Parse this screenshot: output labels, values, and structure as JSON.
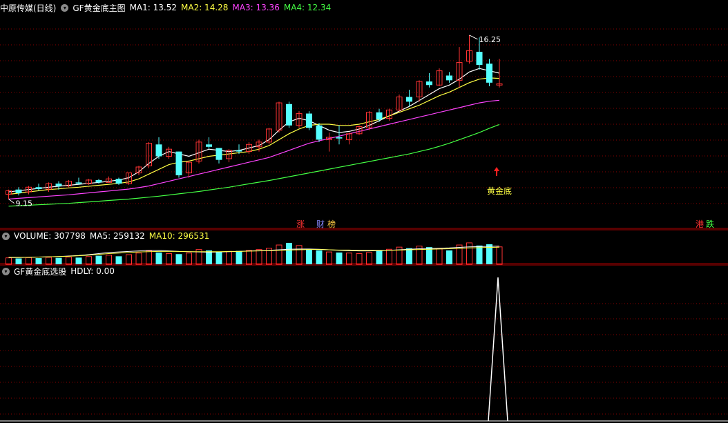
{
  "colors": {
    "background": "#000000",
    "grid": "#8b0000",
    "separator": "#b00000",
    "up": "#ff3333",
    "down": "#54ffff",
    "ma1": "#ffffff",
    "ma2": "#ffff44",
    "ma3": "#ff44ff",
    "ma4": "#44ff44",
    "signal": "#ffffff"
  },
  "main_header": {
    "stock": "中原传媒(日线)",
    "indicator": "GF黄金底主图",
    "ma1": "MA1: 13.52",
    "ma2": "MA2: 14.28",
    "ma3": "MA3: 13.36",
    "ma4": "MA4: 12.34"
  },
  "volume_header": {
    "label": "VOLUME: 307798",
    "ma5": "MA5: 259132",
    "ma10": "MA10: 296531"
  },
  "signal_header": {
    "label": "GF黄金底选股",
    "value": "HDLY: 0.00"
  },
  "badges": [
    {
      "text": "涨",
      "color": "#ff3333"
    },
    {
      "text": "财",
      "color": "#8888ff"
    },
    {
      "text": "榜",
      "color": "#ffcc44"
    },
    {
      "text": "港",
      "color": "#ff3333"
    },
    {
      "text": "跌",
      "color": "#44ff44"
    }
  ],
  "chart_data": {
    "type": "candlestick",
    "high_label": "16.25",
    "low_label": "9.15",
    "signal_label": "黄金底",
    "signal_index": 49,
    "price_range": [
      8.4,
      17.0
    ],
    "candles": [
      [
        9.4,
        9.6,
        9.2,
        9.55
      ],
      [
        9.6,
        9.7,
        9.35,
        9.45
      ],
      [
        9.5,
        9.75,
        9.4,
        9.7
      ],
      [
        9.7,
        9.85,
        9.55,
        9.62
      ],
      [
        9.62,
        9.9,
        9.5,
        9.85
      ],
      [
        9.85,
        9.95,
        9.6,
        9.75
      ],
      [
        9.75,
        10.0,
        9.7,
        9.95
      ],
      [
        9.9,
        10.1,
        9.8,
        9.85
      ],
      [
        9.85,
        10.05,
        9.8,
        10.0
      ],
      [
        10.0,
        10.05,
        9.85,
        9.9
      ],
      [
        9.9,
        10.15,
        9.9,
        10.05
      ],
      [
        10.05,
        10.1,
        9.8,
        9.85
      ],
      [
        9.85,
        10.3,
        9.8,
        10.3
      ],
      [
        10.3,
        10.6,
        10.2,
        10.55
      ],
      [
        10.6,
        11.6,
        10.5,
        11.55
      ],
      [
        11.5,
        11.8,
        10.9,
        11.0
      ],
      [
        11.0,
        11.4,
        10.9,
        11.3
      ],
      [
        11.2,
        11.2,
        10.1,
        10.2
      ],
      [
        10.3,
        10.8,
        10.1,
        10.75
      ],
      [
        10.8,
        11.7,
        10.7,
        11.6
      ],
      [
        11.5,
        11.8,
        11.3,
        11.4
      ],
      [
        11.35,
        11.35,
        10.7,
        10.85
      ],
      [
        10.9,
        11.3,
        10.75,
        11.25
      ],
      [
        11.25,
        11.5,
        11.1,
        11.2
      ],
      [
        11.2,
        11.6,
        11.1,
        11.5
      ],
      [
        11.4,
        11.7,
        11.2,
        11.6
      ],
      [
        11.6,
        12.2,
        11.5,
        12.15
      ],
      [
        12.1,
        13.3,
        12.0,
        13.25
      ],
      [
        13.2,
        13.3,
        12.2,
        12.3
      ],
      [
        12.3,
        12.9,
        12.2,
        12.8
      ],
      [
        12.8,
        12.9,
        12.1,
        12.2
      ],
      [
        12.3,
        12.4,
        11.6,
        11.7
      ],
      [
        11.7,
        12.0,
        11.2,
        11.8
      ],
      [
        11.8,
        12.3,
        11.5,
        11.75
      ],
      [
        11.7,
        12.0,
        11.5,
        11.95
      ],
      [
        11.95,
        12.3,
        11.9,
        12.25
      ],
      [
        12.2,
        12.9,
        12.1,
        12.85
      ],
      [
        12.85,
        13.0,
        12.45,
        12.55
      ],
      [
        12.6,
        13.0,
        12.5,
        12.95
      ],
      [
        12.95,
        13.6,
        12.9,
        13.5
      ],
      [
        13.5,
        13.8,
        13.1,
        13.3
      ],
      [
        13.5,
        14.2,
        13.3,
        14.15
      ],
      [
        14.15,
        14.5,
        13.9,
        14.0
      ],
      [
        14.0,
        14.7,
        13.95,
        14.6
      ],
      [
        14.4,
        14.55,
        14.1,
        14.2
      ],
      [
        14.2,
        15.6,
        13.9,
        14.95
      ],
      [
        15.0,
        16.1,
        14.9,
        15.45
      ],
      [
        15.4,
        16.0,
        14.65,
        14.85
      ],
      [
        14.9,
        15.1,
        13.95,
        14.1
      ],
      [
        14.0,
        15.1,
        13.9,
        14.05
      ]
    ],
    "ma_series": {
      "MA1": [
        9.5,
        9.55,
        9.6,
        9.65,
        9.7,
        9.74,
        9.78,
        9.82,
        9.86,
        9.9,
        9.95,
        10.0,
        10.1,
        10.35,
        10.7,
        11.0,
        11.2,
        11.1,
        11.0,
        11.15,
        11.3,
        11.25,
        11.2,
        11.25,
        11.35,
        11.45,
        11.7,
        12.1,
        12.45,
        12.6,
        12.5,
        12.3,
        12.1,
        12.0,
        12.05,
        12.15,
        12.3,
        12.5,
        12.7,
        12.9,
        13.1,
        13.35,
        13.6,
        13.85,
        14.0,
        14.25,
        14.55,
        14.7,
        14.6,
        14.5
      ],
      "MA2": [
        9.4,
        9.45,
        9.5,
        9.55,
        9.6,
        9.63,
        9.67,
        9.7,
        9.74,
        9.78,
        9.82,
        9.86,
        9.92,
        10.05,
        10.25,
        10.45,
        10.65,
        10.75,
        10.8,
        10.9,
        11.0,
        11.05,
        11.1,
        11.15,
        11.2,
        11.3,
        11.45,
        11.7,
        11.95,
        12.15,
        12.3,
        12.35,
        12.35,
        12.3,
        12.3,
        12.35,
        12.45,
        12.55,
        12.7,
        12.85,
        13.0,
        13.15,
        13.35,
        13.55,
        13.7,
        13.9,
        14.1,
        14.25,
        14.3,
        14.28
      ],
      "MA3": [
        9.2,
        9.23,
        9.26,
        9.29,
        9.32,
        9.35,
        9.38,
        9.42,
        9.46,
        9.5,
        9.54,
        9.58,
        9.62,
        9.68,
        9.75,
        9.85,
        9.95,
        10.05,
        10.15,
        10.25,
        10.35,
        10.45,
        10.55,
        10.65,
        10.75,
        10.85,
        10.95,
        11.1,
        11.25,
        11.4,
        11.55,
        11.65,
        11.75,
        11.85,
        11.95,
        12.05,
        12.15,
        12.25,
        12.35,
        12.45,
        12.55,
        12.65,
        12.75,
        12.85,
        12.95,
        13.05,
        13.15,
        13.25,
        13.32,
        13.36
      ],
      "MA4": [
        8.9,
        8.92,
        8.94,
        8.96,
        8.98,
        9.0,
        9.02,
        9.05,
        9.08,
        9.11,
        9.14,
        9.17,
        9.2,
        9.24,
        9.28,
        9.32,
        9.37,
        9.42,
        9.47,
        9.52,
        9.58,
        9.64,
        9.7,
        9.77,
        9.84,
        9.91,
        9.98,
        10.06,
        10.14,
        10.22,
        10.3,
        10.38,
        10.46,
        10.54,
        10.62,
        10.7,
        10.78,
        10.86,
        10.94,
        11.02,
        11.1,
        11.2,
        11.3,
        11.42,
        11.55,
        11.7,
        11.85,
        12.0,
        12.18,
        12.34
      ]
    },
    "volumes": [
      24,
      22,
      25,
      23,
      26,
      24,
      27,
      25,
      29,
      32,
      34,
      30,
      36,
      42,
      50,
      44,
      40,
      38,
      42,
      55,
      52,
      46,
      48,
      50,
      52,
      55,
      60,
      72,
      80,
      70,
      58,
      52,
      46,
      44,
      42,
      40,
      44,
      50,
      56,
      64,
      60,
      68,
      64,
      58,
      52,
      72,
      80,
      70,
      75,
      65
    ],
    "vol_ma5": [
      25,
      25,
      26,
      27,
      28,
      29,
      31,
      33,
      36,
      40,
      44,
      46,
      48,
      50,
      52,
      52,
      50,
      48,
      47,
      46,
      45,
      46,
      47,
      48,
      50,
      51,
      52,
      54,
      56,
      57,
      57,
      56,
      54,
      52,
      51,
      50,
      50,
      51,
      52,
      54,
      56,
      58,
      59,
      60,
      61,
      63,
      65,
      66,
      67,
      68
    ],
    "vol_ma10": [
      26,
      26,
      26,
      27,
      28,
      29,
      30,
      32,
      34,
      37,
      40,
      42,
      44,
      46,
      47,
      48,
      48,
      48,
      47,
      47,
      47,
      47,
      48,
      48,
      49,
      50,
      51,
      52,
      53,
      54,
      55,
      55,
      54,
      53,
      53,
      52,
      52,
      52,
      52,
      53,
      54,
      55,
      56,
      57,
      58,
      59,
      61,
      62,
      63,
      64
    ],
    "signal": [
      0,
      0,
      0,
      0,
      0,
      0,
      0,
      0,
      0,
      0,
      0,
      0,
      0,
      0,
      0,
      0,
      0,
      0,
      0,
      0,
      0,
      0,
      0,
      0,
      0,
      0,
      0,
      0,
      0,
      0,
      0,
      0,
      0,
      0,
      0,
      0,
      0,
      0,
      0,
      0,
      0,
      0,
      0,
      0,
      0,
      0,
      0,
      0,
      0,
      1,
      0,
      0,
      0,
      0,
      0,
      0,
      0,
      0,
      0,
      0,
      0,
      0,
      0,
      0,
      0,
      0,
      0,
      0,
      0,
      0,
      0
    ]
  }
}
